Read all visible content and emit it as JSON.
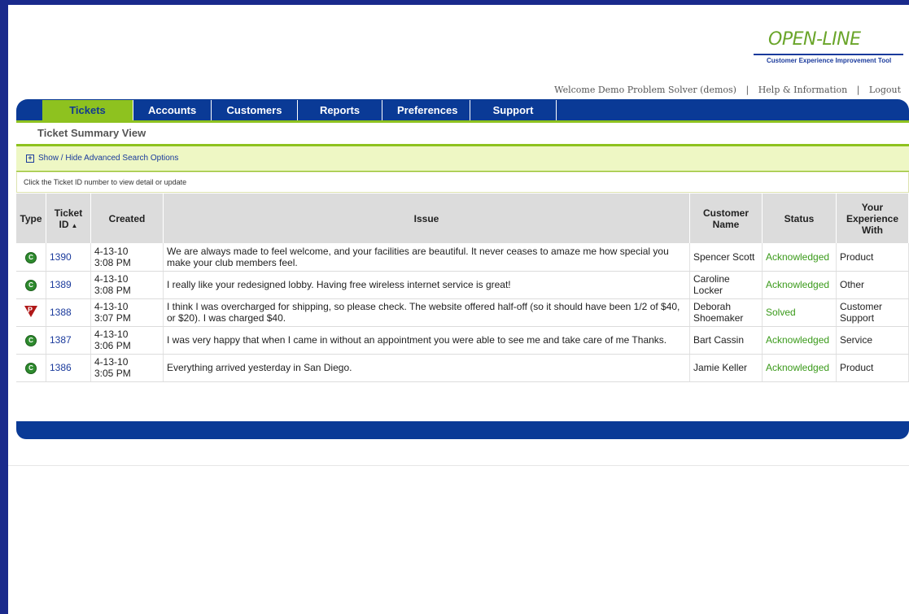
{
  "brand": {
    "logo_text": "OPEN-LINE",
    "tagline": "Customer Experience Improvement Tool"
  },
  "topnav": {
    "welcome": "Welcome Demo Problem Solver (demos)",
    "help": "Help & Information",
    "logout": "Logout"
  },
  "tabs": [
    {
      "label": "Tickets",
      "active": true
    },
    {
      "label": "Accounts"
    },
    {
      "label": "Customers"
    },
    {
      "label": "Reports"
    },
    {
      "label": "Preferences"
    },
    {
      "label": "Support"
    }
  ],
  "page_title": "Ticket Summary View",
  "advanced_search": "Show / Hide Advanced Search Options",
  "hint": "Click the Ticket ID number to view detail or update",
  "columns": {
    "type": "Type",
    "ticket_id": "Ticket ID",
    "created": "Created",
    "issue": "Issue",
    "customer_name": "Customer Name",
    "status": "Status",
    "experience": "Your Experience With"
  },
  "rows": [
    {
      "type": "compliment",
      "type_icon": "C",
      "id": "1390",
      "date": "4-13-10",
      "time": "3:08 PM",
      "issue": "We are always made to feel welcome, and your facilities are beautiful. It never ceases to amaze me how special you make your club members feel.",
      "customer": "Spencer Scott",
      "status": "Acknowledged",
      "experience": "Product"
    },
    {
      "type": "compliment",
      "type_icon": "C",
      "id": "1389",
      "date": "4-13-10",
      "time": "3:08 PM",
      "issue": "I really like your redesigned lobby. Having free wireless internet service is great!",
      "customer": "Caroline Locker",
      "status": "Acknowledged",
      "experience": "Other"
    },
    {
      "type": "problem",
      "type_icon": "P",
      "id": "1388",
      "date": "4-13-10",
      "time": "3:07 PM",
      "issue": "I think I was overcharged for shipping, so please check. The website offered half-off (so it should have been 1/2 of $40, or $20). I was charged $40.",
      "customer": "Deborah Shoemaker",
      "status": "Solved",
      "experience": "Customer Support"
    },
    {
      "type": "compliment",
      "type_icon": "C",
      "id": "1387",
      "date": "4-13-10",
      "time": "3:06 PM",
      "issue": "I was very happy that when I came in without an appointment you were able to see me and take care of me Thanks.",
      "customer": "Bart Cassin",
      "status": "Acknowledged",
      "experience": "Service"
    },
    {
      "type": "compliment",
      "type_icon": "C",
      "id": "1386",
      "date": "4-13-10",
      "time": "3:05 PM",
      "issue": "Everything arrived yesterday in San Diego.",
      "customer": "Jamie Keller",
      "status": "Acknowledged",
      "experience": "Product"
    }
  ],
  "colors": {
    "frame": "#1a2a8c",
    "nav_blue": "#0a3a96",
    "accent_green": "#8ec21f",
    "status_green": "#3a9a1a",
    "problem_red": "#b01818"
  }
}
